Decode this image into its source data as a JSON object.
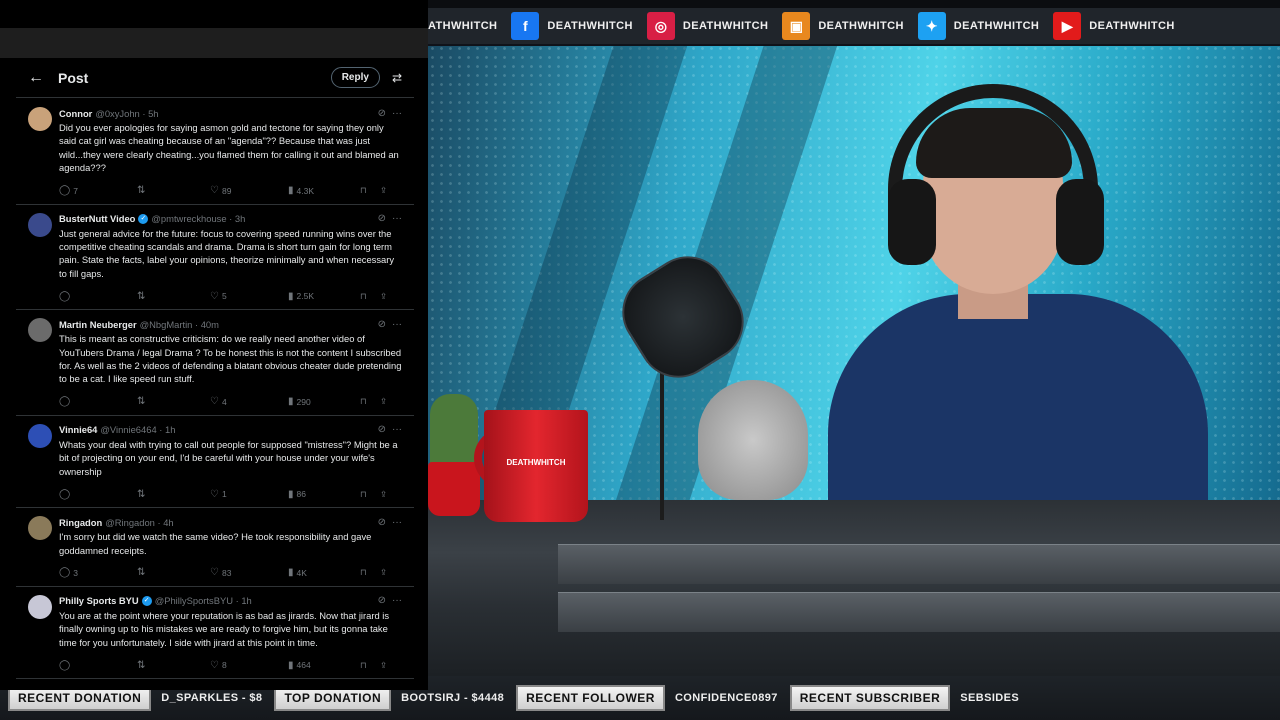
{
  "top_bar": {
    "items": [
      {
        "platform": "twitch-partial",
        "name": "DEATHWHITCH",
        "partial_name": "ATHWHITCH",
        "color": "#20252b",
        "icon": ""
      },
      {
        "platform": "facebook",
        "name": "DEATHWHITCH",
        "color": "#1877f2",
        "icon": "f"
      },
      {
        "platform": "instagram",
        "name": "DEATHWHITCH",
        "color": "#d81f45",
        "icon": "◎"
      },
      {
        "platform": "twitch",
        "name": "DEATHWHITCH",
        "color": "#e8881e",
        "icon": "▣"
      },
      {
        "platform": "twitter",
        "name": "DEATHWHITCH",
        "color": "#1da1f2",
        "icon": "✦"
      },
      {
        "platform": "youtube",
        "name": "DEATHWHITCH",
        "color": "#e21b1b",
        "icon": "▶"
      }
    ]
  },
  "scene": {
    "mug_text": "DEATHWHITCH"
  },
  "ticker": {
    "recent_donation_label": "RECENT DONATION",
    "recent_donation_value": "D_SPARKLES - $8",
    "top_donation_label": "TOP DONATION",
    "top_donation_value": "BOOTSIRJ - $4448",
    "recent_follower_label": "RECENT FOLLOWER",
    "recent_follower_value": "CONFIDENCE0897",
    "recent_subscriber_label": "RECENT SUBSCRIBER",
    "recent_subscriber_value": "SEBSIDES"
  },
  "post_header": {
    "back_icon": "←",
    "title": "Post",
    "reply_button": "Reply",
    "settings_icon": "⇄"
  },
  "tweets": [
    {
      "name": "Connor",
      "verified": false,
      "handle": "@0xyJohn · 5h",
      "avatar_color": "#c9a27a",
      "text": "Did you ever apologies for saying asmon gold and tectone for saying they only said cat girl was cheating because of an \"agenda\"?? Because that was just wild...they were clearly cheating...you flamed them for calling it out and blamed an agenda???",
      "replies": "7",
      "retweets": "",
      "likes": "89",
      "views": "4.3K"
    },
    {
      "name": "BusterNutt Video",
      "verified": true,
      "handle": "@pmtwreckhouse · 3h",
      "avatar_color": "#3a4a8c",
      "text": "Just general advice for the future: focus to covering speed running wins over the competitive cheating scandals and drama. Drama is short turn gain for long term pain. State the facts, label your opinions, theorize minimally and when necessary to fill gaps.",
      "replies": "",
      "retweets": "",
      "likes": "5",
      "views": "2.5K"
    },
    {
      "name": "Martin Neuberger",
      "verified": false,
      "handle": "@NbgMartin · 40m",
      "avatar_color": "#6b6b6b",
      "text": "This is meant as constructive criticism: do we really need another video of YouTubers Drama / legal Drama ? To be honest this is not the content I subscribed for. As well as the 2 videos of defending a blatant obvious cheater dude pretending to be a cat. I like speed run stuff.",
      "replies": "",
      "retweets": "",
      "likes": "4",
      "views": "290"
    },
    {
      "name": "Vinnie64",
      "verified": false,
      "handle": "@Vinnie6464 · 1h",
      "avatar_color": "#2d4fb5",
      "text": "Whats your deal with trying to call out people for supposed \"mistress\"? Might be a bit of projecting on your end, I'd be careful with your house under your wife's ownership",
      "replies": "",
      "retweets": "",
      "likes": "1",
      "views": "86"
    },
    {
      "name": "Ringadon",
      "verified": false,
      "handle": "@Ringadon · 4h",
      "avatar_color": "#8a7a5a",
      "text": "I'm sorry but did we watch the same video? He took responsibility and gave goddamned receipts.",
      "replies": "3",
      "retweets": "",
      "likes": "83",
      "views": "4K"
    },
    {
      "name": "Philly Sports BYU",
      "verified": true,
      "handle": "@PhillySportsBYU · 1h",
      "avatar_color": "#c7c7d6",
      "text": "You are at the point where your reputation is as bad as jirards. Now that jirard is finally owning up to his mistakes we are ready to forgive him, but its gonna take time for you unfortunately. I side with jirard at this point in time.",
      "replies": "",
      "retweets": "",
      "likes": "8",
      "views": "464"
    }
  ]
}
